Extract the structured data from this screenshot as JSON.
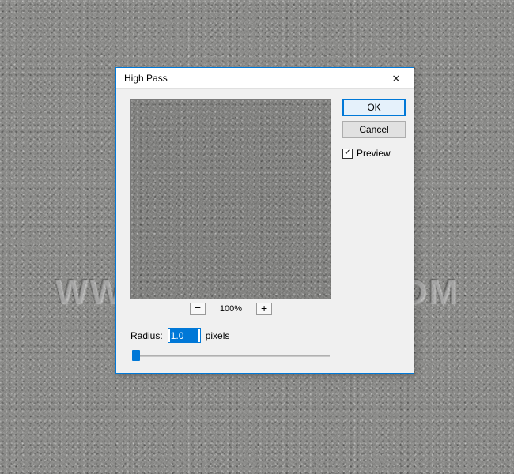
{
  "watermark": "WWW.PSD-DUDE.COM",
  "dialog": {
    "title": "High Pass",
    "buttons": {
      "ok": "OK",
      "cancel": "Cancel"
    },
    "preview_checkbox": {
      "label": "Preview",
      "checked": true
    },
    "zoom": {
      "minus": "−",
      "plus": "+",
      "level": "100%"
    },
    "radius": {
      "label": "Radius:",
      "value": "1.0",
      "unit": "pixels"
    }
  }
}
